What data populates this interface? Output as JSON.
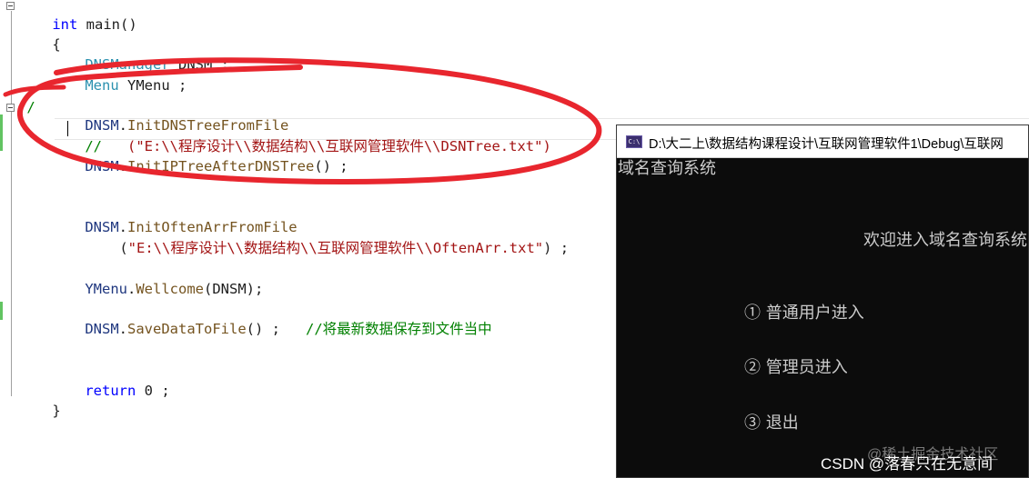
{
  "editor": {
    "code": {
      "l1": {
        "kw": "int",
        "rest": " main()"
      },
      "l2": "{",
      "l3": {
        "type": "DNSManager",
        "rest": " DNSM ;"
      },
      "l4": {
        "type": "Menu",
        "rest": " YMenu ;"
      },
      "l5": {
        "comment": "//",
        "obj": "DNSM",
        "dot": ".",
        "fn": "InitDNSTreeFromFile"
      },
      "l6": {
        "comment": "//",
        "arg": "(\"E:\\\\程序设计\\\\数据结构\\\\互联网管理软件\\\\DSNTree.txt\")"
      },
      "l7": {
        "obj": "DNSM",
        "dot": ".",
        "fn": "InitIPTreeAfterDNSTree",
        "rest": "() ;"
      },
      "l8": {
        "obj": "DNSM",
        "dot": ".",
        "fn": "InitOftenArrFromFile"
      },
      "l9": {
        "open": "(",
        "arg": "\"E:\\\\程序设计\\\\数据结构\\\\互联网管理软件\\\\OftenArr.txt\"",
        "close": ") ;"
      },
      "l10": {
        "obj": "YMenu",
        "dot": ".",
        "fn": "Wellcome",
        "rest": "(DNSM);"
      },
      "l11": {
        "obj": "DNSM",
        "dot": ".",
        "fn": "SaveDataToFile",
        "rest": "() ;   ",
        "comment": "//将最新数据保存到文件当中"
      },
      "l12": {
        "kw": "return",
        "rest": " 0 ;"
      },
      "l13": "}"
    }
  },
  "console": {
    "icon_label": "C:\\",
    "title": "D:\\大二上\\数据结构课程设计\\互联网管理软件1\\Debug\\互联网",
    "header": "域名查询系统",
    "welcome": "欢迎进入域名查询系统",
    "menu": [
      "① 普通用户进入",
      "② 管理员进入",
      "③ 退出"
    ]
  },
  "watermark": {
    "primary": "CSDN @落春只在无意间",
    "secondary": "@稀土掘金技术社区"
  },
  "colors": {
    "annotation": "#e8262e",
    "console_bg": "#0c0c0c",
    "keyword": "#0000ff",
    "string": "#a31515",
    "comment": "#008000"
  }
}
